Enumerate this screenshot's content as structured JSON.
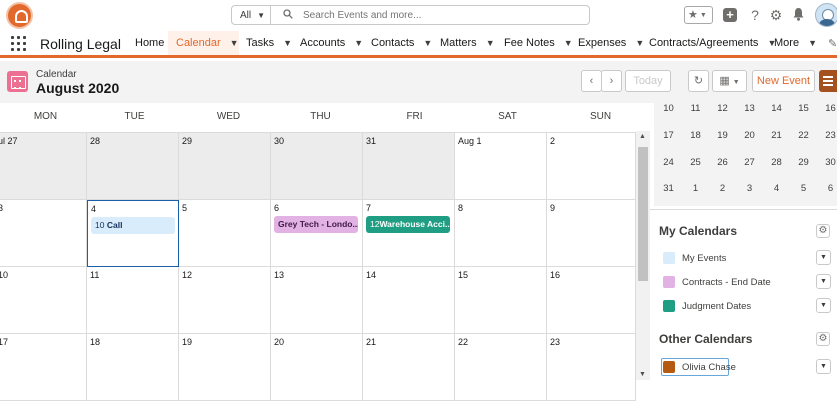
{
  "header": {
    "search_scope": "All",
    "search_placeholder": "Search Events and more..."
  },
  "nav": {
    "app_name": "Rolling Legal",
    "items": [
      {
        "label": "Home"
      },
      {
        "label": "Calendar"
      },
      {
        "label": "Tasks"
      },
      {
        "label": "Accounts"
      },
      {
        "label": "Contacts"
      },
      {
        "label": "Matters"
      },
      {
        "label": "Fee Notes"
      },
      {
        "label": "Expenses"
      },
      {
        "label": "Contracts/Agreements"
      },
      {
        "label": "More"
      }
    ]
  },
  "page": {
    "object_label": "Calendar",
    "title": "August 2020",
    "today_label": "Today",
    "new_event_label": "New Event"
  },
  "calendar": {
    "days_of_week": [
      "MON",
      "TUE",
      "WED",
      "THU",
      "FRI",
      "SAT",
      "SUN"
    ],
    "weeks": [
      [
        "ul 27",
        "28",
        "29",
        "30",
        "31",
        "Aug 1",
        "2"
      ],
      [
        "3",
        "4",
        "5",
        "6",
        "7",
        "8",
        "9"
      ],
      [
        "10",
        "11",
        "12",
        "13",
        "14",
        "15",
        "16"
      ],
      [
        "17",
        "18",
        "19",
        "20",
        "21",
        "22",
        "23"
      ]
    ],
    "events": {
      "call": {
        "hour": "10",
        "title": "Call"
      },
      "grey": {
        "title": "Grey Tech - Londo..."
      },
      "warehouse": {
        "hour": "12",
        "title": "Warehouse Acci..."
      }
    }
  },
  "mini_calendar": {
    "rows": [
      [
        "10",
        "11",
        "12",
        "13",
        "14",
        "15",
        "16"
      ],
      [
        "17",
        "18",
        "19",
        "20",
        "21",
        "22",
        "23"
      ],
      [
        "24",
        "25",
        "26",
        "27",
        "28",
        "29",
        "30"
      ],
      [
        "31",
        "1",
        "2",
        "3",
        "4",
        "5",
        "6"
      ]
    ]
  },
  "sidebar": {
    "my_calendars_title": "My Calendars",
    "my_calendars": [
      {
        "label": "My Events",
        "color": "#d8ecfb"
      },
      {
        "label": "Contracts - End Date",
        "color": "#e3b2e4"
      },
      {
        "label": "Judgment Dates",
        "color": "#1f9e83"
      }
    ],
    "other_calendars_title": "Other Calendars",
    "other_calendars": [
      {
        "label": "Olivia Chase",
        "color": "#b65a12"
      }
    ]
  },
  "colors": {
    "accent": "#e2682b",
    "event_my_events": "#d8ecfb",
    "event_contracts": "#e3b2e4",
    "event_judgment": "#1f9e83",
    "today_border": "#1b5faa"
  }
}
